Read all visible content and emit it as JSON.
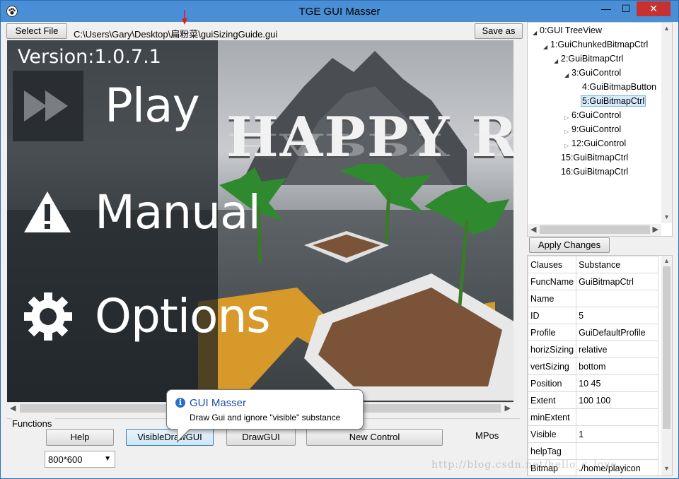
{
  "window": {
    "title": "TGE GUI Masser",
    "min_glyph": "—",
    "max_glyph": "☐",
    "close_glyph": "✕",
    "icons": {
      "app": "paw-icon"
    }
  },
  "toolbar": {
    "select_file_label": "Select File",
    "file_path": "C:\\Users\\Gary\\Desktop\\扁粉菜\\guiSizingGuide.gui",
    "save_as_label": "Save as"
  },
  "preview": {
    "version": "Version:1.0.7.1",
    "menu": [
      {
        "label": "Play",
        "icon": "fast-forward-icon"
      },
      {
        "label": "Manual",
        "icon": "warning-icon"
      },
      {
        "label": "Options",
        "icon": "gear-icon"
      }
    ],
    "banner": "HAPPY ROI"
  },
  "functions": {
    "group_label": "Functions",
    "help_label": "Help",
    "visible_draw_label": "VisibleDrawGUI",
    "draw_label": "DrawGUI",
    "new_control_label": "New Control",
    "mpos_label": "MPos",
    "resolution": "800*600"
  },
  "tooltip": {
    "title": "GUI Masser",
    "body": "Draw Gui and ignore \"visible\" substance",
    "icon": "info-icon"
  },
  "tree": {
    "nodes": [
      {
        "label": "0:GUI TreeView"
      },
      {
        "label": "1:GuiChunkedBitmapCtrl"
      },
      {
        "label": "2:GuiBitmapCtrl"
      },
      {
        "label": "3:GuiControl"
      },
      {
        "label": "4:GuiBitmapButton"
      },
      {
        "label": "5:GuiBitmapCtrl"
      },
      {
        "label": "6:GuiControl"
      },
      {
        "label": "9:GuiControl"
      },
      {
        "label": "12:GuiControl"
      },
      {
        "label": "15:GuiBitmapCtrl"
      },
      {
        "label": "16:GuiBitmapCtrl"
      }
    ]
  },
  "apply_changes_label": "Apply Changes",
  "properties": {
    "header": {
      "key": "Clauses",
      "value": "Substance"
    },
    "rows": [
      {
        "key": "FuncName",
        "value": "GuiBitmapCtrl"
      },
      {
        "key": "Name",
        "value": ""
      },
      {
        "key": "ID",
        "value": "5"
      },
      {
        "key": "Profile",
        "value": "GuiDefaultProfile"
      },
      {
        "key": "horizSizing",
        "value": "relative"
      },
      {
        "key": "vertSizing",
        "value": "bottom"
      },
      {
        "key": "Position",
        "value": "10 45"
      },
      {
        "key": "Extent",
        "value": "100 100"
      },
      {
        "key": "minExtent",
        "value": ""
      },
      {
        "key": "Visible",
        "value": "1"
      },
      {
        "key": "helpTag",
        "value": ""
      },
      {
        "key": "Bitmap",
        "value": "./home/playicon"
      }
    ]
  },
  "watermark": "http://blog.csdn.net/hello_c_love",
  "colors": {
    "titlebar": "#4a8fd6",
    "close": "#c7312f",
    "tooltip_title": "#1d4fa0",
    "selected_node": "#d7ecfa"
  }
}
